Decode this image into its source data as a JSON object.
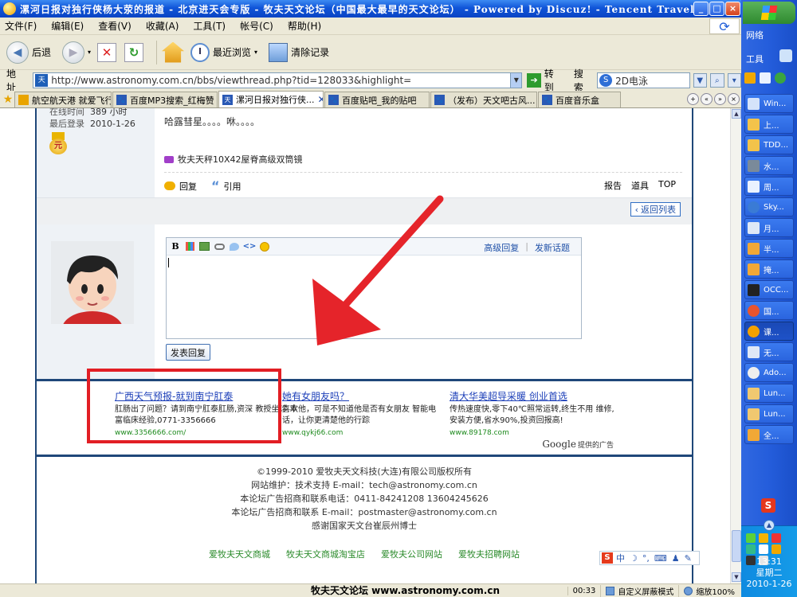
{
  "window": {
    "title": "漯河日报对独行侠杨大荥的报道 - 北京进天会专版 - 牧夫天文论坛（中国最大最早的天文论坛） - Powered by Discuz! - Tencent Traveler"
  },
  "menu": [
    "文件(F)",
    "编辑(E)",
    "查看(V)",
    "收藏(A)",
    "工具(T)",
    "帐号(C)",
    "帮助(H)"
  ],
  "toolbar": {
    "back": "后退",
    "recent": "最近浏览",
    "clear": "清除记录"
  },
  "address": {
    "label": "地址",
    "url": "http://www.astronomy.com.cn/bbs/viewthread.php?tid=128033&highlight=",
    "go": "转到",
    "search_label": "搜索",
    "search_value": "2D电泳"
  },
  "tabs": [
    {
      "label": "航空航天港 就爱飞行..."
    },
    {
      "label": "百度MP3搜索_红梅赞"
    },
    {
      "label": "漯河日报对独行侠...",
      "active": true
    },
    {
      "label": "百度贴吧_我的贴吧"
    },
    {
      "label": "（发布）天文吧古风..."
    },
    {
      "label": "百度音乐盒"
    }
  ],
  "post": {
    "online_label": "在线时间",
    "online_value": "389 小时",
    "last_login_label": "最后登录",
    "last_login_value": "2010-1-26",
    "medal_text": "元",
    "body": "哈露彗星。。。。咻。。。。",
    "signature": "牧夫天秤10X42屋脊高级双筒镜",
    "reply": "回复",
    "quote": "引用",
    "links": [
      "报告",
      "道具",
      "TOP"
    ]
  },
  "back_to_list": "返回列表",
  "editor": {
    "advanced": "高级回复",
    "new_topic": "发新话题",
    "submit": "发表回复"
  },
  "ads": [
    {
      "title": "广西天气预报-就到南宁肛泰",
      "desc": "肛肠出了问题？请到南宁肛泰肛肠,资深  教授坐诊,丰富临床经验,0771-3356666",
      "url": "www.3356666.com/"
    },
    {
      "title": "她有女朋友吗？",
      "desc": "喜欢他，可是不知道他是否有女朋友 智能电话，让你更清楚他的行踪",
      "url": "www.qykj66.com"
    },
    {
      "title": "清大华美超导采暖 创业首选",
      "desc": "传热速度快,零下40℃照常运转,终生不用 维修,安装方便,省水90%,投资回报高!",
      "url": "www.89178.com"
    }
  ],
  "google": {
    "logo": "Google",
    "text": "提供的广告"
  },
  "footer": {
    "lines": [
      "©1999-2010 爱牧夫天文科技(大连)有限公司版权所有",
      "网站维护：技术支持 E-mail：tech@astronomy.com.cn",
      "本论坛广告招商和联系电话：0411-84241208 13604245626",
      "本论坛广告招商和联系 E-mail：postmaster@astronomy.com.cn",
      "感谢国家天文台崔辰州博士"
    ],
    "links": [
      "爱牧夫天文商城",
      "牧夫天文商城淘宝店",
      "爱牧夫公司网站",
      "爱牧夫招聘网站"
    ]
  },
  "ime": {
    "logo": "S",
    "mode": "中"
  },
  "status": {
    "brand": "牧夫天文论坛 www.astronomy.com.cn",
    "time": "00:33",
    "screen_mode": "自定义屏蔽模式",
    "zoom": "缩放100%"
  },
  "taskbar": {
    "net": "网络",
    "tools": "工具",
    "items": [
      "Win...",
      "上...",
      "TDD...",
      "水...",
      "周...",
      "Sky...",
      "月...",
      "半...",
      "掩...",
      "OCC...",
      "国...",
      "课...",
      "无...",
      "Ado...",
      "Lun...",
      "Lun...",
      "全..."
    ],
    "clock_time": "13:31",
    "clock_day": "星期二",
    "clock_date": "2010-1-26"
  },
  "colors": {
    "accent": "#1f4779",
    "highlight_box": "#e21e24",
    "ad_link": "#1b3eb8"
  }
}
